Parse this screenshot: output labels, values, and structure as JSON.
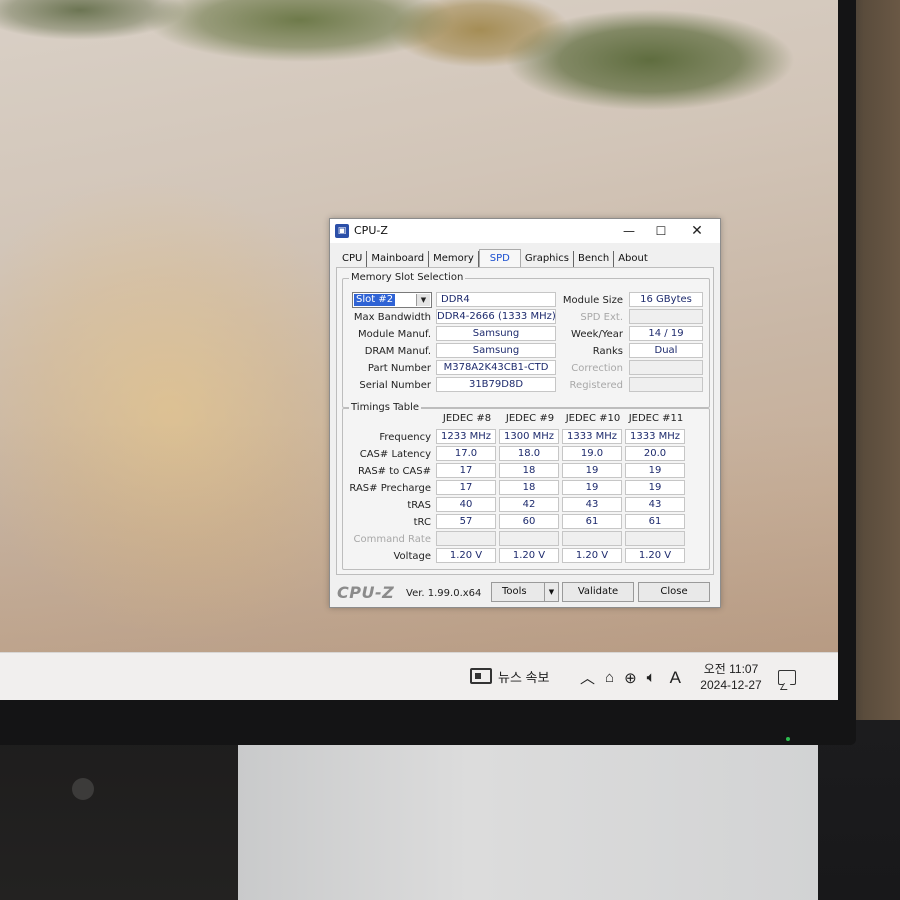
{
  "window": {
    "title": "CPU-Z",
    "icon": "cpuz-app-icon",
    "controls": {
      "minimize": "—",
      "maximize": "☐",
      "close": "✕"
    }
  },
  "tabs": [
    {
      "label": "CPU",
      "active": false
    },
    {
      "label": "Mainboard",
      "active": false
    },
    {
      "label": "Memory",
      "active": false
    },
    {
      "label": "SPD",
      "active": true
    },
    {
      "label": "Graphics",
      "active": false
    },
    {
      "label": "Bench",
      "active": false
    },
    {
      "label": "About",
      "active": false
    }
  ],
  "slot_section": {
    "title": "Memory Slot Selection",
    "selected_slot": "Slot #2",
    "memory_type": "DDR4",
    "module_size_label": "Module Size",
    "module_size": "16 GBytes",
    "max_bandwidth_label": "Max Bandwidth",
    "max_bandwidth": "DDR4-2666 (1333 MHz)",
    "spd_ext_label": "SPD Ext.",
    "spd_ext": "",
    "module_manuf_label": "Module Manuf.",
    "module_manuf": "Samsung",
    "week_year_label": "Week/Year",
    "week_year": "14 / 19",
    "dram_manuf_label": "DRAM Manuf.",
    "dram_manuf": "Samsung",
    "ranks_label": "Ranks",
    "ranks": "Dual",
    "part_number_label": "Part Number",
    "part_number": "M378A2K43CB1-CTD",
    "correction_label": "Correction",
    "correction": "",
    "serial_number_label": "Serial Number",
    "serial_number": "31B79D8D",
    "registered_label": "Registered",
    "registered": ""
  },
  "timings": {
    "title": "Timings Table",
    "columns": [
      "JEDEC #8",
      "JEDEC #9",
      "JEDEC #10",
      "JEDEC #11"
    ],
    "rows": [
      {
        "label": "Frequency",
        "values": [
          "1233 MHz",
          "1300 MHz",
          "1333 MHz",
          "1333 MHz"
        ],
        "disabled": false
      },
      {
        "label": "CAS# Latency",
        "values": [
          "17.0",
          "18.0",
          "19.0",
          "20.0"
        ],
        "disabled": false
      },
      {
        "label": "RAS# to CAS#",
        "values": [
          "17",
          "18",
          "19",
          "19"
        ],
        "disabled": false
      },
      {
        "label": "RAS# Precharge",
        "values": [
          "17",
          "18",
          "19",
          "19"
        ],
        "disabled": false
      },
      {
        "label": "tRAS",
        "values": [
          "40",
          "42",
          "43",
          "43"
        ],
        "disabled": false
      },
      {
        "label": "tRC",
        "values": [
          "57",
          "60",
          "61",
          "61"
        ],
        "disabled": false
      },
      {
        "label": "Command Rate",
        "values": [
          "",
          "",
          "",
          ""
        ],
        "disabled": true
      },
      {
        "label": "Voltage",
        "values": [
          "1.20 V",
          "1.20 V",
          "1.20 V",
          "1.20 V"
        ],
        "disabled": false
      }
    ]
  },
  "footer": {
    "brand": "CPU-Z",
    "version": "Ver. 1.99.0.x64",
    "tools_label": "Tools",
    "validate_label": "Validate",
    "close_label": "Close"
  },
  "taskbar": {
    "news_label": "뉴스 속보",
    "ime_label": "A",
    "time_line1": "오전 11:07",
    "time_line2": "2024-12-27",
    "tray_icons": [
      "chevron-up-icon",
      "ime-mode-icon",
      "network-globe-icon",
      "speaker-icon"
    ]
  },
  "colors": {
    "value_text": "#1d2a6d",
    "active_tab": "#1a4fd0",
    "selection": "#2f63d5",
    "window_bg": "#f0f0f0",
    "taskbar_bg": "#f1efee"
  }
}
